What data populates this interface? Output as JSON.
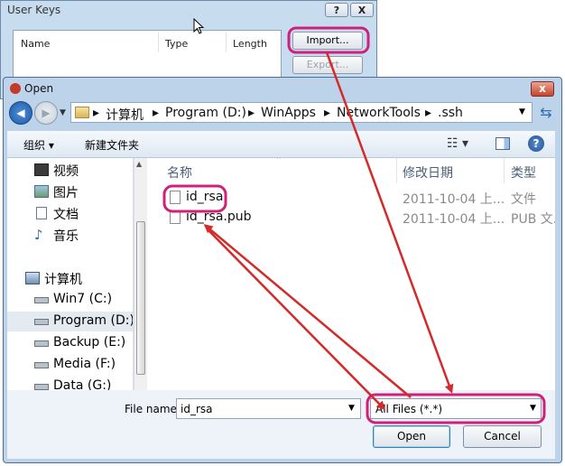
{
  "user_keys": {
    "title": "User Keys",
    "help_btn": "?",
    "close_btn": "X",
    "columns": [
      "Name",
      "Type",
      "Length"
    ],
    "import_label": "Import...",
    "export_label": "Export..."
  },
  "dialog": {
    "title": "Open",
    "close_btn": "x",
    "breadcrumbs": [
      "计算机",
      "Program (D:)",
      "WinApps",
      "NetworkTools",
      ".ssh"
    ],
    "toolbar": {
      "organize": "组织 ▾",
      "new_folder": "新建文件夹",
      "help": "?"
    },
    "sidebar": {
      "libraries": [
        "视频",
        "图片",
        "文档",
        "音乐"
      ],
      "computer": "计算机",
      "drives": [
        "Win7 (C:)",
        "Program (D:)",
        "Backup (E:)",
        "Media (F:)",
        "Data (G:)"
      ]
    },
    "columns": {
      "name": "名称",
      "date": "修改日期",
      "type": "类型"
    },
    "files": [
      {
        "name": "id_rsa",
        "date": "2011-10-04 上...",
        "type": "文件"
      },
      {
        "name": "id_rsa.pub",
        "date": "2011-10-04 上...",
        "type": "PUB 文..."
      }
    ],
    "filename_label": "File name:",
    "filename_value": "id_rsa",
    "filter_value": "All Files (*.*)",
    "open_label": "Open",
    "cancel_label": "Cancel"
  },
  "colors": {
    "highlight": "#d0207c",
    "arrow": "#d42a2a"
  }
}
